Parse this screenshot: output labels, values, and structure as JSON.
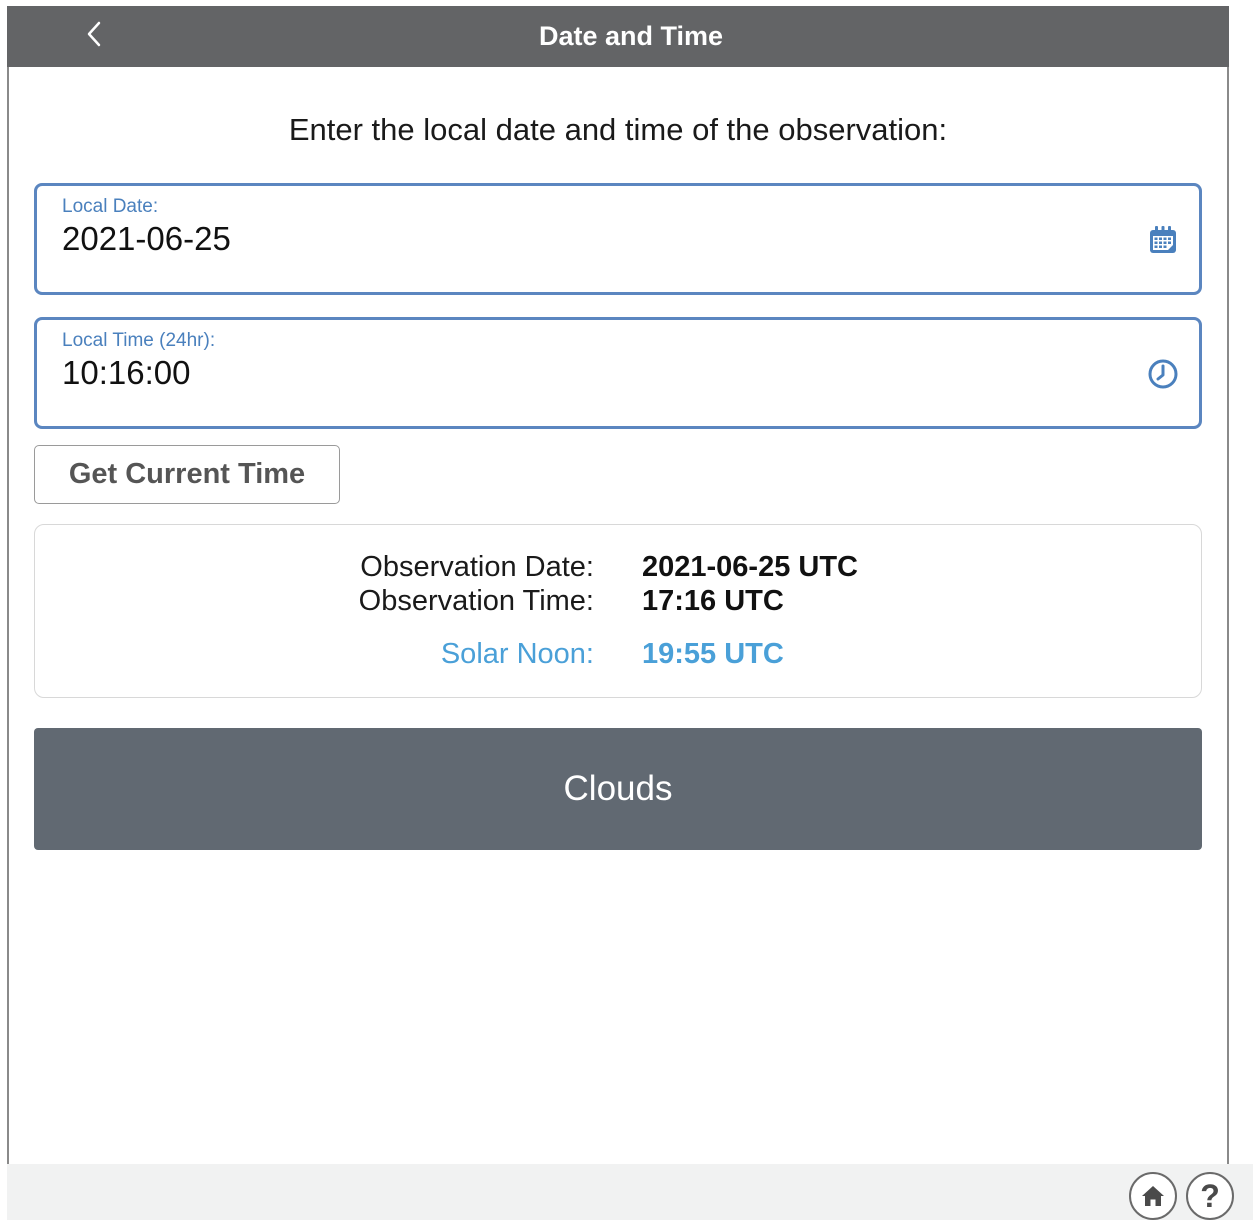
{
  "header": {
    "title": "Date and Time",
    "back_icon": "chevron-left-icon"
  },
  "prompt": "Enter the local date and time of the observation:",
  "local_date": {
    "label": "Local Date:",
    "value": "2021-06-25",
    "icon": "calendar-icon"
  },
  "local_time": {
    "label": "Local Time (24hr):",
    "value": "10:16:00",
    "icon": "clock-icon"
  },
  "get_current_time_label": "Get Current Time",
  "summary": {
    "observation_date_label": "Observation Date:",
    "observation_date_value": "2021-06-25 UTC",
    "observation_time_label": "Observation Time:",
    "observation_time_value": "17:16 UTC",
    "solar_noon_label": "Solar Noon:",
    "solar_noon_value": "19:55 UTC"
  },
  "next_button_label": "Clouds",
  "footer": {
    "home_icon": "home-icon",
    "help_icon": "help-icon",
    "help_glyph": "?"
  },
  "colors": {
    "header_bg": "#636466",
    "accent_blue": "#4a80bd",
    "solar_noon_blue": "#4aa0d8",
    "primary_button_bg": "#616972"
  }
}
